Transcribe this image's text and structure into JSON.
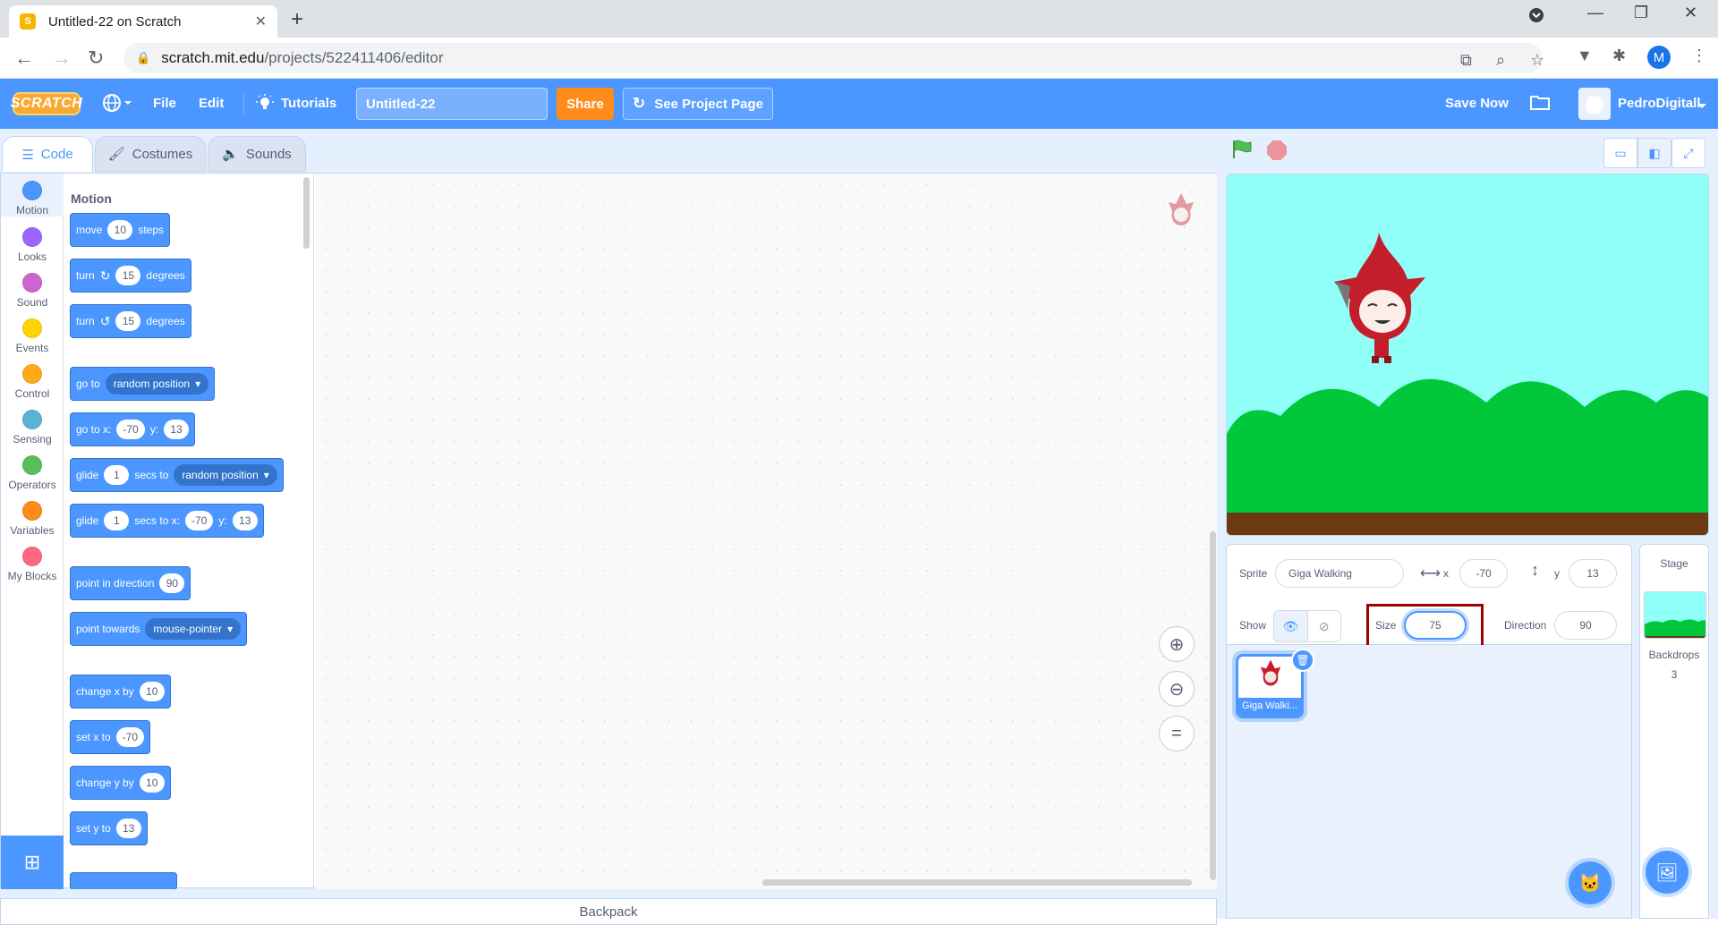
{
  "browser": {
    "tab_title": "Untitled-22 on Scratch",
    "url_host": "scratch.mit.edu",
    "url_path": "/projects/522411406/editor",
    "profile_initial": "M"
  },
  "menubar": {
    "logo": "SCRATCH",
    "file": "File",
    "edit": "Edit",
    "tutorials": "Tutorials",
    "project_title": "Untitled-22",
    "share": "Share",
    "see_project_page": "See Project Page",
    "save_now": "Save Now",
    "username": "PedroDigitall"
  },
  "editor_tabs": {
    "code": "Code",
    "costumes": "Costumes",
    "sounds": "Sounds"
  },
  "categories": [
    {
      "label": "Motion",
      "color": "#4c97ff"
    },
    {
      "label": "Looks",
      "color": "#9966ff"
    },
    {
      "label": "Sound",
      "color": "#cf63cf"
    },
    {
      "label": "Events",
      "color": "#ffd500"
    },
    {
      "label": "Control",
      "color": "#ffab19"
    },
    {
      "label": "Sensing",
      "color": "#5cb1d6"
    },
    {
      "label": "Operators",
      "color": "#59c059"
    },
    {
      "label": "Variables",
      "color": "#ff8c1a"
    },
    {
      "label": "My Blocks",
      "color": "#ff6680"
    }
  ],
  "palette": {
    "title": "Motion",
    "blocks": {
      "move": {
        "pre": "move",
        "val": "10",
        "post": "steps"
      },
      "turn_cw": {
        "pre": "turn",
        "val": "15",
        "post": "degrees"
      },
      "turn_ccw": {
        "pre": "turn",
        "val": "15",
        "post": "degrees"
      },
      "goto": {
        "pre": "go to",
        "drop": "random position"
      },
      "goto_xy": {
        "pre": "go to x:",
        "x": "-70",
        "mid": "y:",
        "y": "13"
      },
      "glide_to": {
        "pre": "glide",
        "val": "1",
        "mid": "secs to",
        "drop": "random position"
      },
      "glide_xy": {
        "pre": "glide",
        "val": "1",
        "mid": "secs to x:",
        "x": "-70",
        "mid2": "y:",
        "y": "13"
      },
      "point_dir": {
        "pre": "point in direction",
        "val": "90"
      },
      "point_towards": {
        "pre": "point towards",
        "drop": "mouse-pointer"
      },
      "change_x": {
        "pre": "change x by",
        "val": "10"
      },
      "set_x": {
        "pre": "set x to",
        "val": "-70"
      },
      "change_y": {
        "pre": "change y by",
        "val": "10"
      },
      "set_y": {
        "pre": "set y to",
        "val": "13"
      }
    }
  },
  "backpack": "Backpack",
  "sprite_info": {
    "sprite_label": "Sprite",
    "sprite_name": "Giga Walking",
    "x_label": "x",
    "x_value": "-70",
    "y_label": "y",
    "y_value": "13",
    "show_label": "Show",
    "size_label": "Size",
    "size_value": "75",
    "direction_label": "Direction",
    "direction_value": "90"
  },
  "sprite_tile": {
    "name": "Giga Walki..."
  },
  "stage_panel": {
    "title": "Stage",
    "backdrops_label": "Backdrops",
    "backdrops_count": "3"
  },
  "colors": {
    "scratch_blue": "#4c97ff",
    "share_orange": "#ff8c1a",
    "highlight_red": "#a00000"
  }
}
